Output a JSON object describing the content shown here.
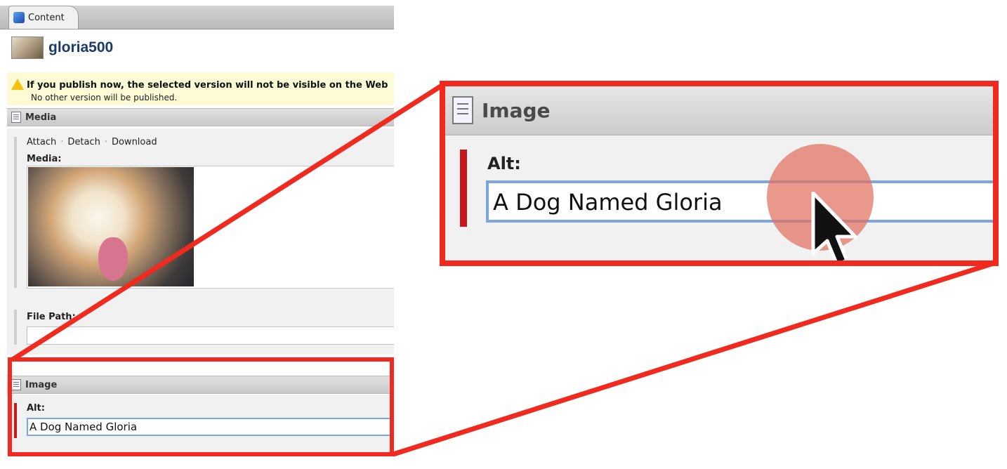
{
  "tab": {
    "label": "Content"
  },
  "page": {
    "title": "gloria500"
  },
  "warning": {
    "title": "If you publish now, the selected version will not be visible on the Web",
    "subtitle": "No other version will be published."
  },
  "media_section": {
    "heading": "Media",
    "links": [
      "Attach",
      "Detach",
      "Download"
    ],
    "media_label": "Media:",
    "file_path_label": "File Path:",
    "file_path_value": ""
  },
  "image_section": {
    "heading": "Image",
    "alt_label": "Alt:",
    "alt_value": "A Dog Named Gloria"
  },
  "annotation": {
    "highlight_color": "#f02a1e",
    "cursor_highlight_color": "#e27060"
  }
}
